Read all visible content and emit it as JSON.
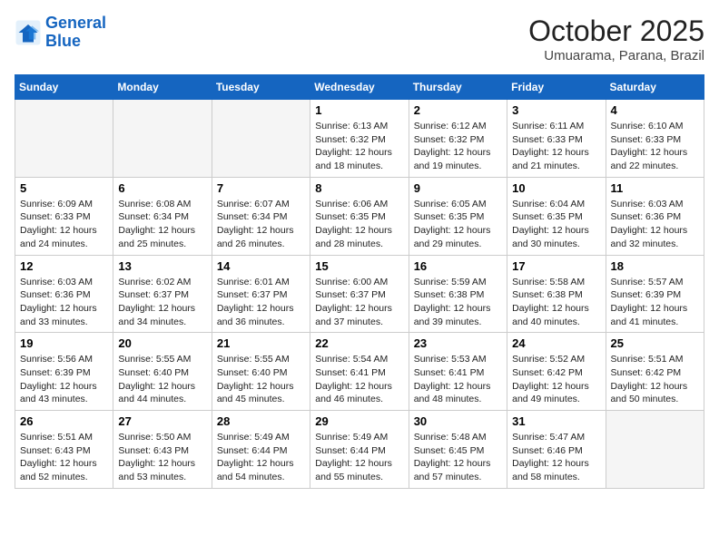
{
  "header": {
    "logo_line1": "General",
    "logo_line2": "Blue",
    "month_title": "October 2025",
    "location": "Umuarama, Parana, Brazil"
  },
  "days_of_week": [
    "Sunday",
    "Monday",
    "Tuesday",
    "Wednesday",
    "Thursday",
    "Friday",
    "Saturday"
  ],
  "weeks": [
    [
      {
        "num": "",
        "info": ""
      },
      {
        "num": "",
        "info": ""
      },
      {
        "num": "",
        "info": ""
      },
      {
        "num": "1",
        "info": "Sunrise: 6:13 AM\nSunset: 6:32 PM\nDaylight: 12 hours and 18 minutes."
      },
      {
        "num": "2",
        "info": "Sunrise: 6:12 AM\nSunset: 6:32 PM\nDaylight: 12 hours and 19 minutes."
      },
      {
        "num": "3",
        "info": "Sunrise: 6:11 AM\nSunset: 6:33 PM\nDaylight: 12 hours and 21 minutes."
      },
      {
        "num": "4",
        "info": "Sunrise: 6:10 AM\nSunset: 6:33 PM\nDaylight: 12 hours and 22 minutes."
      }
    ],
    [
      {
        "num": "5",
        "info": "Sunrise: 6:09 AM\nSunset: 6:33 PM\nDaylight: 12 hours and 24 minutes."
      },
      {
        "num": "6",
        "info": "Sunrise: 6:08 AM\nSunset: 6:34 PM\nDaylight: 12 hours and 25 minutes."
      },
      {
        "num": "7",
        "info": "Sunrise: 6:07 AM\nSunset: 6:34 PM\nDaylight: 12 hours and 26 minutes."
      },
      {
        "num": "8",
        "info": "Sunrise: 6:06 AM\nSunset: 6:35 PM\nDaylight: 12 hours and 28 minutes."
      },
      {
        "num": "9",
        "info": "Sunrise: 6:05 AM\nSunset: 6:35 PM\nDaylight: 12 hours and 29 minutes."
      },
      {
        "num": "10",
        "info": "Sunrise: 6:04 AM\nSunset: 6:35 PM\nDaylight: 12 hours and 30 minutes."
      },
      {
        "num": "11",
        "info": "Sunrise: 6:03 AM\nSunset: 6:36 PM\nDaylight: 12 hours and 32 minutes."
      }
    ],
    [
      {
        "num": "12",
        "info": "Sunrise: 6:03 AM\nSunset: 6:36 PM\nDaylight: 12 hours and 33 minutes."
      },
      {
        "num": "13",
        "info": "Sunrise: 6:02 AM\nSunset: 6:37 PM\nDaylight: 12 hours and 34 minutes."
      },
      {
        "num": "14",
        "info": "Sunrise: 6:01 AM\nSunset: 6:37 PM\nDaylight: 12 hours and 36 minutes."
      },
      {
        "num": "15",
        "info": "Sunrise: 6:00 AM\nSunset: 6:37 PM\nDaylight: 12 hours and 37 minutes."
      },
      {
        "num": "16",
        "info": "Sunrise: 5:59 AM\nSunset: 6:38 PM\nDaylight: 12 hours and 39 minutes."
      },
      {
        "num": "17",
        "info": "Sunrise: 5:58 AM\nSunset: 6:38 PM\nDaylight: 12 hours and 40 minutes."
      },
      {
        "num": "18",
        "info": "Sunrise: 5:57 AM\nSunset: 6:39 PM\nDaylight: 12 hours and 41 minutes."
      }
    ],
    [
      {
        "num": "19",
        "info": "Sunrise: 5:56 AM\nSunset: 6:39 PM\nDaylight: 12 hours and 43 minutes."
      },
      {
        "num": "20",
        "info": "Sunrise: 5:55 AM\nSunset: 6:40 PM\nDaylight: 12 hours and 44 minutes."
      },
      {
        "num": "21",
        "info": "Sunrise: 5:55 AM\nSunset: 6:40 PM\nDaylight: 12 hours and 45 minutes."
      },
      {
        "num": "22",
        "info": "Sunrise: 5:54 AM\nSunset: 6:41 PM\nDaylight: 12 hours and 46 minutes."
      },
      {
        "num": "23",
        "info": "Sunrise: 5:53 AM\nSunset: 6:41 PM\nDaylight: 12 hours and 48 minutes."
      },
      {
        "num": "24",
        "info": "Sunrise: 5:52 AM\nSunset: 6:42 PM\nDaylight: 12 hours and 49 minutes."
      },
      {
        "num": "25",
        "info": "Sunrise: 5:51 AM\nSunset: 6:42 PM\nDaylight: 12 hours and 50 minutes."
      }
    ],
    [
      {
        "num": "26",
        "info": "Sunrise: 5:51 AM\nSunset: 6:43 PM\nDaylight: 12 hours and 52 minutes."
      },
      {
        "num": "27",
        "info": "Sunrise: 5:50 AM\nSunset: 6:43 PM\nDaylight: 12 hours and 53 minutes."
      },
      {
        "num": "28",
        "info": "Sunrise: 5:49 AM\nSunset: 6:44 PM\nDaylight: 12 hours and 54 minutes."
      },
      {
        "num": "29",
        "info": "Sunrise: 5:49 AM\nSunset: 6:44 PM\nDaylight: 12 hours and 55 minutes."
      },
      {
        "num": "30",
        "info": "Sunrise: 5:48 AM\nSunset: 6:45 PM\nDaylight: 12 hours and 57 minutes."
      },
      {
        "num": "31",
        "info": "Sunrise: 5:47 AM\nSunset: 6:46 PM\nDaylight: 12 hours and 58 minutes."
      },
      {
        "num": "",
        "info": ""
      }
    ]
  ]
}
